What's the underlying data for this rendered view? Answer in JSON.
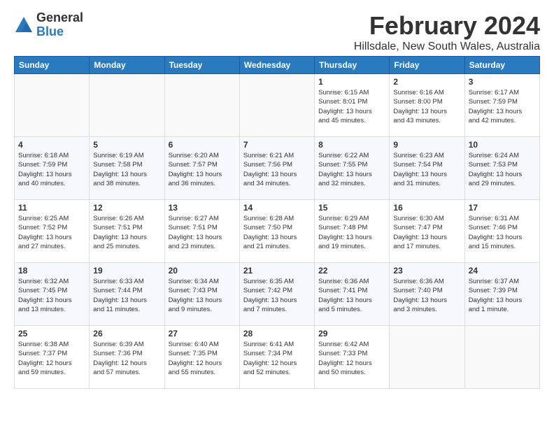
{
  "logo": {
    "general": "General",
    "blue": "Blue"
  },
  "title": "February 2024",
  "location": "Hillsdale, New South Wales, Australia",
  "days_header": [
    "Sunday",
    "Monday",
    "Tuesday",
    "Wednesday",
    "Thursday",
    "Friday",
    "Saturday"
  ],
  "weeks": [
    [
      {
        "num": "",
        "info": ""
      },
      {
        "num": "",
        "info": ""
      },
      {
        "num": "",
        "info": ""
      },
      {
        "num": "",
        "info": ""
      },
      {
        "num": "1",
        "info": "Sunrise: 6:15 AM\nSunset: 8:01 PM\nDaylight: 13 hours\nand 45 minutes."
      },
      {
        "num": "2",
        "info": "Sunrise: 6:16 AM\nSunset: 8:00 PM\nDaylight: 13 hours\nand 43 minutes."
      },
      {
        "num": "3",
        "info": "Sunrise: 6:17 AM\nSunset: 7:59 PM\nDaylight: 13 hours\nand 42 minutes."
      }
    ],
    [
      {
        "num": "4",
        "info": "Sunrise: 6:18 AM\nSunset: 7:59 PM\nDaylight: 13 hours\nand 40 minutes."
      },
      {
        "num": "5",
        "info": "Sunrise: 6:19 AM\nSunset: 7:58 PM\nDaylight: 13 hours\nand 38 minutes."
      },
      {
        "num": "6",
        "info": "Sunrise: 6:20 AM\nSunset: 7:57 PM\nDaylight: 13 hours\nand 36 minutes."
      },
      {
        "num": "7",
        "info": "Sunrise: 6:21 AM\nSunset: 7:56 PM\nDaylight: 13 hours\nand 34 minutes."
      },
      {
        "num": "8",
        "info": "Sunrise: 6:22 AM\nSunset: 7:55 PM\nDaylight: 13 hours\nand 32 minutes."
      },
      {
        "num": "9",
        "info": "Sunrise: 6:23 AM\nSunset: 7:54 PM\nDaylight: 13 hours\nand 31 minutes."
      },
      {
        "num": "10",
        "info": "Sunrise: 6:24 AM\nSunset: 7:53 PM\nDaylight: 13 hours\nand 29 minutes."
      }
    ],
    [
      {
        "num": "11",
        "info": "Sunrise: 6:25 AM\nSunset: 7:52 PM\nDaylight: 13 hours\nand 27 minutes."
      },
      {
        "num": "12",
        "info": "Sunrise: 6:26 AM\nSunset: 7:51 PM\nDaylight: 13 hours\nand 25 minutes."
      },
      {
        "num": "13",
        "info": "Sunrise: 6:27 AM\nSunset: 7:51 PM\nDaylight: 13 hours\nand 23 minutes."
      },
      {
        "num": "14",
        "info": "Sunrise: 6:28 AM\nSunset: 7:50 PM\nDaylight: 13 hours\nand 21 minutes."
      },
      {
        "num": "15",
        "info": "Sunrise: 6:29 AM\nSunset: 7:48 PM\nDaylight: 13 hours\nand 19 minutes."
      },
      {
        "num": "16",
        "info": "Sunrise: 6:30 AM\nSunset: 7:47 PM\nDaylight: 13 hours\nand 17 minutes."
      },
      {
        "num": "17",
        "info": "Sunrise: 6:31 AM\nSunset: 7:46 PM\nDaylight: 13 hours\nand 15 minutes."
      }
    ],
    [
      {
        "num": "18",
        "info": "Sunrise: 6:32 AM\nSunset: 7:45 PM\nDaylight: 13 hours\nand 13 minutes."
      },
      {
        "num": "19",
        "info": "Sunrise: 6:33 AM\nSunset: 7:44 PM\nDaylight: 13 hours\nand 11 minutes."
      },
      {
        "num": "20",
        "info": "Sunrise: 6:34 AM\nSunset: 7:43 PM\nDaylight: 13 hours\nand 9 minutes."
      },
      {
        "num": "21",
        "info": "Sunrise: 6:35 AM\nSunset: 7:42 PM\nDaylight: 13 hours\nand 7 minutes."
      },
      {
        "num": "22",
        "info": "Sunrise: 6:36 AM\nSunset: 7:41 PM\nDaylight: 13 hours\nand 5 minutes."
      },
      {
        "num": "23",
        "info": "Sunrise: 6:36 AM\nSunset: 7:40 PM\nDaylight: 13 hours\nand 3 minutes."
      },
      {
        "num": "24",
        "info": "Sunrise: 6:37 AM\nSunset: 7:39 PM\nDaylight: 13 hours\nand 1 minute."
      }
    ],
    [
      {
        "num": "25",
        "info": "Sunrise: 6:38 AM\nSunset: 7:37 PM\nDaylight: 12 hours\nand 59 minutes."
      },
      {
        "num": "26",
        "info": "Sunrise: 6:39 AM\nSunset: 7:36 PM\nDaylight: 12 hours\nand 57 minutes."
      },
      {
        "num": "27",
        "info": "Sunrise: 6:40 AM\nSunset: 7:35 PM\nDaylight: 12 hours\nand 55 minutes."
      },
      {
        "num": "28",
        "info": "Sunrise: 6:41 AM\nSunset: 7:34 PM\nDaylight: 12 hours\nand 52 minutes."
      },
      {
        "num": "29",
        "info": "Sunrise: 6:42 AM\nSunset: 7:33 PM\nDaylight: 12 hours\nand 50 minutes."
      },
      {
        "num": "",
        "info": ""
      },
      {
        "num": "",
        "info": ""
      }
    ]
  ]
}
